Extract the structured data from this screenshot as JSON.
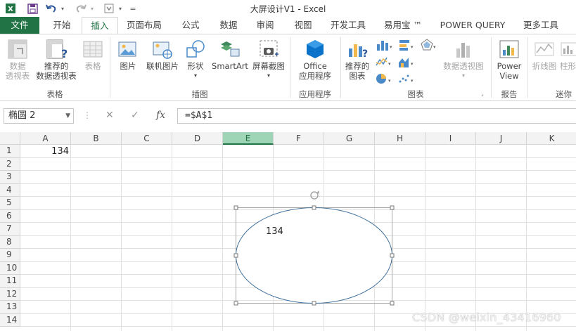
{
  "window": {
    "title": "大屏设计V1 - Excel"
  },
  "tabs": [
    "文件",
    "开始",
    "插入",
    "页面布局",
    "公式",
    "数据",
    "审阅",
    "视图",
    "开发工具",
    "易用宝 ™",
    "POWER QUERY",
    "更多工具"
  ],
  "active_tab": "插入",
  "ribbon": {
    "pivot_label_1": "数据",
    "pivot_label_2": "透视表",
    "rec_pivot_label_1": "推荐的",
    "rec_pivot_label_2": "数据透视表",
    "table_label": "表格",
    "group_tables": "表格",
    "picture_label": "图片",
    "online_picture_label": "联机图片",
    "shapes_label": "形状",
    "smartart_label": "SmartArt",
    "screenshot_label": "屏幕截图",
    "group_illustrations": "插图",
    "office_label_1": "Office",
    "office_label_2": "应用程序",
    "group_apps": "应用程序",
    "rec_chart_label_1": "推荐的",
    "rec_chart_label_2": "图表",
    "pivotchart_label": "数据透视图",
    "group_charts": "图表",
    "powerview_label_1": "Power",
    "powerview_label_2": "View",
    "group_reports": "报告",
    "sparkline_line": "折线图",
    "sparkline_column": "柱形",
    "group_sparklines": "迷你"
  },
  "formula_bar": {
    "name_box": "椭圆 2",
    "formula": "=$A$1"
  },
  "sheet": {
    "columns": [
      "A",
      "B",
      "C",
      "D",
      "E",
      "F",
      "G",
      "H",
      "I",
      "J",
      "K"
    ],
    "rows": [
      "1",
      "2",
      "3",
      "4",
      "5",
      "6",
      "7",
      "8",
      "9",
      "10",
      "11",
      "12",
      "13",
      "14"
    ],
    "selected_column": "E",
    "cell_A1": "134"
  },
  "shape": {
    "type": "ellipse",
    "text": "134",
    "stroke_color": "#41719c"
  },
  "watermark": "CSDN @weixin_43416960",
  "colors": {
    "excel_green": "#217346",
    "header_bg": "#f3f3f3",
    "selected_header": "#9fd5b7"
  }
}
